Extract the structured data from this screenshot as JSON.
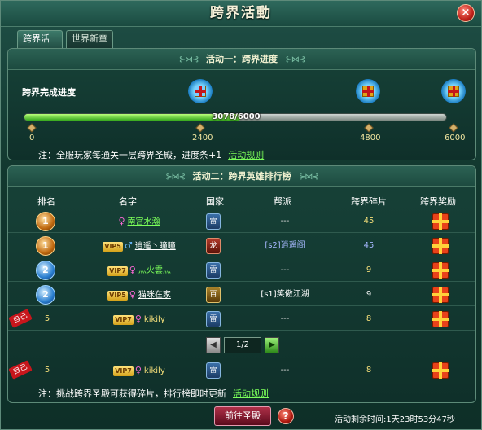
{
  "window": {
    "title": "跨界活動",
    "close_symbol": "×"
  },
  "tabs": [
    {
      "label": "跨界活动",
      "active": true
    },
    {
      "label": "世界新章",
      "active": false
    }
  ],
  "activity1": {
    "title": "活动一：跨界进度",
    "progress_label": "跨界完成进度",
    "progress_text": "3078/6000",
    "progress_current": 3078,
    "progress_max": 6000,
    "ticks": [
      "0",
      "2400",
      "4800",
      "6000"
    ],
    "note": "注：全服玩家每通关一层跨界圣殿，进度条+1",
    "rules_link": "活动规则",
    "gift_colors": [
      "#1a7cc2",
      "#d4a21a",
      "#d4a21a"
    ]
  },
  "activity2": {
    "title": "活动二：跨界英雄排行榜",
    "columns": [
      "排名",
      "名字",
      "国家",
      "帮派",
      "跨界碎片",
      "跨界奖励"
    ],
    "rows": [
      {
        "rank": "1",
        "medal": "gold",
        "vip": "",
        "gender": "♀",
        "name": "南宫水瀚",
        "country": "雷",
        "country_style": "blue",
        "guild": "---",
        "fragments": "45"
      },
      {
        "rank": "1",
        "medal": "gold",
        "vip": "VIP5",
        "gender": "♂",
        "name": "逍遥丶瞳瞳",
        "country": "龙",
        "country_style": "red",
        "guild": "[s2]逍遥阁",
        "fragments": "45"
      },
      {
        "rank": "2",
        "medal": "blue",
        "vip": "VIP7",
        "gender": "♀",
        "name": "灬火雲灬",
        "country": "雷",
        "country_style": "blue",
        "guild": "---",
        "fragments": "9"
      },
      {
        "rank": "2",
        "medal": "blue",
        "vip": "VIP5",
        "gender": "♀",
        "name": "猫咪在家",
        "country": "百",
        "country_style": "gold",
        "guild": "[s1]笑傲江湖",
        "fragments": "9"
      },
      {
        "rank": "5",
        "medal": "self",
        "self_tag": "自己",
        "vip": "VIP7",
        "gender": "♀",
        "name": "kikily",
        "country": "雷",
        "country_style": "blue",
        "guild": "---",
        "fragments": "8"
      }
    ],
    "pager": {
      "text": "1/2",
      "prev": "◀",
      "next": "▶"
    },
    "self_row": {
      "self_tag": "自己",
      "rank": "5",
      "vip": "VIP7",
      "gender": "♀",
      "name": "kikily",
      "country": "雷",
      "guild": "---",
      "fragments": "8"
    },
    "note": "注：挑战跨界圣殿可获得碎片，排行榜即时更新",
    "rules_link": "活动规则"
  },
  "bottom": {
    "go_button": "前往圣殿",
    "help_symbol": "?",
    "timer": "活动剩余时间:1天23时53分47秒"
  }
}
